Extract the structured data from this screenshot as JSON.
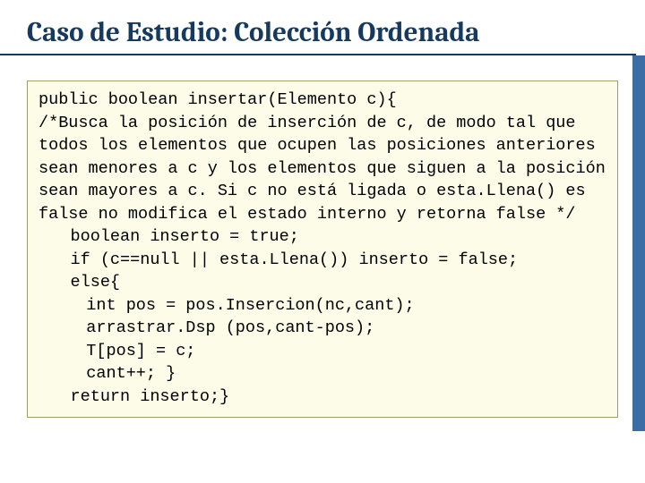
{
  "title": "Caso de Estudio: Colección Ordenada",
  "code": {
    "sig": "public boolean insertar(Elemento c){",
    "comment": "/*Busca la posición de inserción de c, de modo tal que todos los elementos que ocupen las posiciones anteriores sean menores a c y los elementos que siguen a la posición sean mayores a c. Si c no está ligada o esta.Llena() es false no modifica el estado interno y retorna false */",
    "l1": "boolean inserto = true;",
    "l2": "if (c==null || esta.Llena()) inserto = false;",
    "l3": "else{",
    "l4": "int pos = pos.Insercion(nc,cant);",
    "l5": "arrastrar.Dsp (pos,cant-pos);",
    "l6": "T[pos] = c;",
    "l7": "cant++; }",
    "l8": "return inserto;}"
  }
}
